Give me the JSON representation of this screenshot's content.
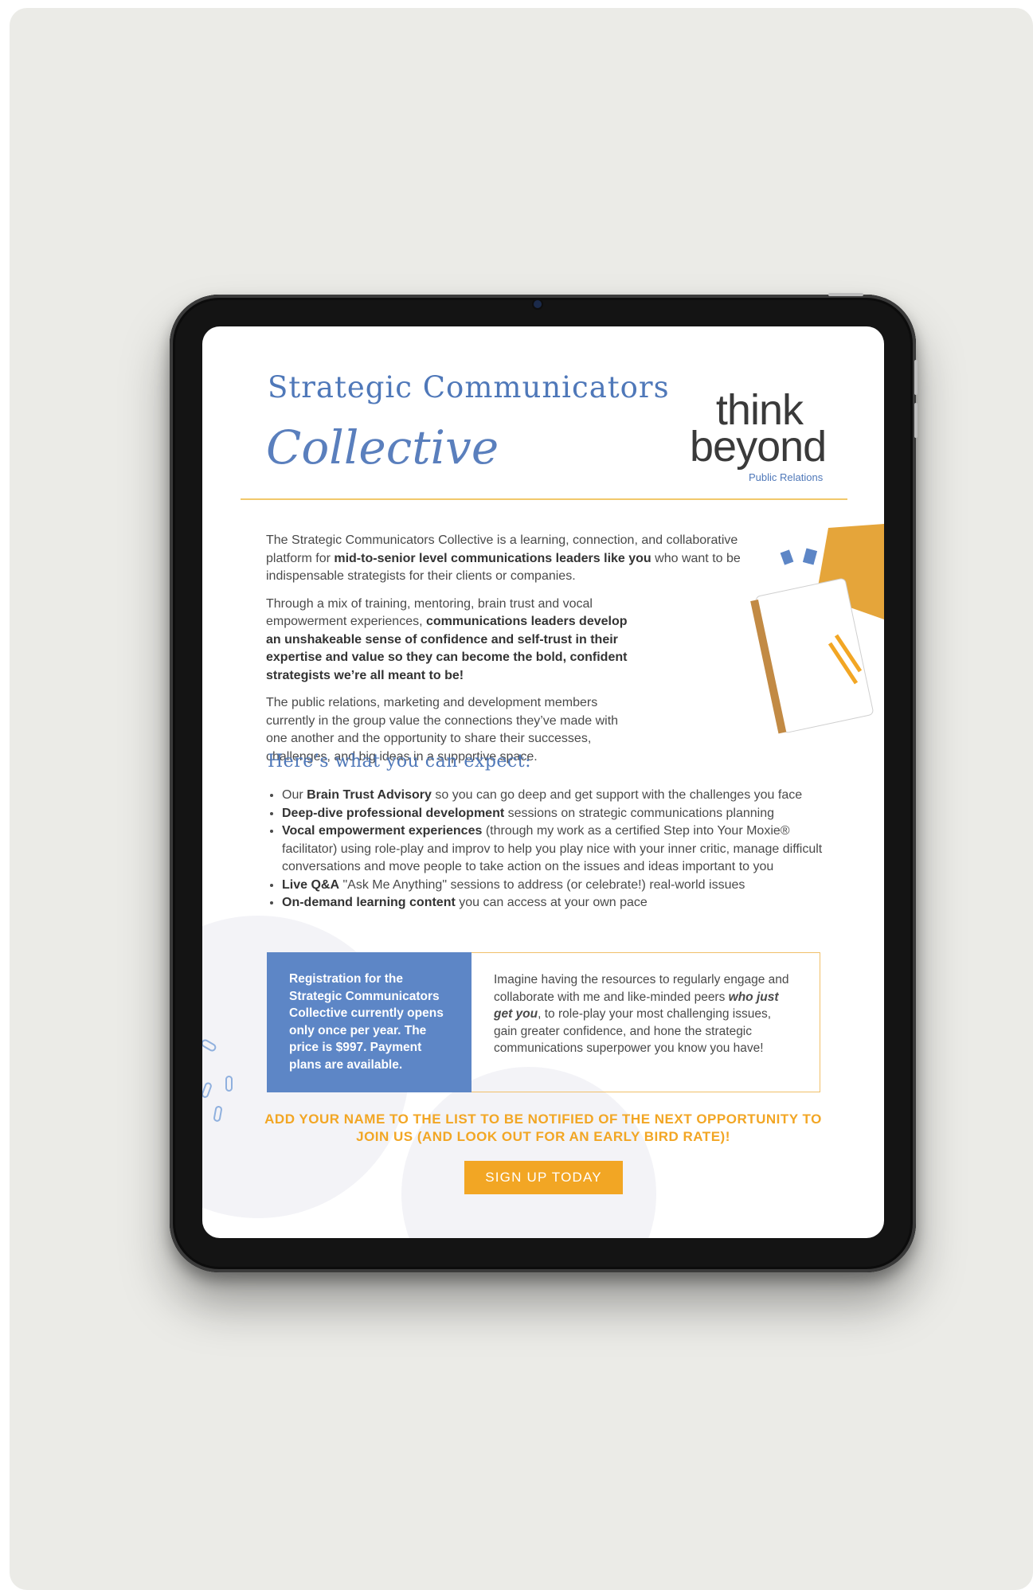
{
  "document": {
    "title_line1": "Strategic Communicators",
    "title_line2": "Collective",
    "logo": {
      "line1": "think",
      "line2": "beyond",
      "line3": "Public Relations"
    },
    "intro_paragraphs": [
      {
        "before": "The Strategic Communicators Collective is a learning, connection, and collaborative platform for ",
        "bold": "mid-to-senior level communications leaders like you",
        "after": " who want to be indispensable strategists for their clients or companies."
      },
      {
        "before": "Through a mix of training, mentoring, brain trust and vocal empowerment experiences, ",
        "bold": "communications leaders develop an unshakeable sense of confidence and self-trust in their expertise and value so they can become the bold, confident strategists we’re all meant to be!",
        "after": ""
      },
      {
        "before": "The public relations, marketing and development members currently in the group value the connections they’ve made with one another and the opportunity to share their successes, challenges, and big ideas in a supportive space.",
        "bold": "",
        "after": ""
      }
    ],
    "expect_heading": "Here’s what you can expect:",
    "bullets": [
      {
        "before": "Our ",
        "bold": "Brain Trust Advisory",
        "after": " so you can go deep and get support with the challenges you face"
      },
      {
        "before": "",
        "bold": "Deep-dive professional development",
        "after": " sessions on strategic communications planning"
      },
      {
        "before": "",
        "bold": "Vocal empowerment experiences",
        "after": " (through my work as a certified Step into Your Moxie® facilitator) using role-play and improv to help you play nice with your inner critic, manage difficult conversations and move people to take action on the issues and ideas important to you"
      },
      {
        "before": "",
        "bold": "Live Q&A",
        "after": " \"Ask Me Anything\" sessions to address (or celebrate!) real-world issues"
      },
      {
        "before": "",
        "bold": "On-demand learning content",
        "after": " you can access at your own pace"
      }
    ],
    "registration_box": "Registration for the Strategic Communicators Collective currently opens only once per year. The price is $997. Payment plans are available.",
    "imagine_box": {
      "before": "Imagine having the resources to regularly engage and collaborate with me and like-minded peers ",
      "bold": "who just get you",
      "after": ", to role-play your most challenging issues, gain greater confidence, and hone the strategic communications superpower you know you have!"
    },
    "cta_text": "ADD YOUR NAME TO THE LIST TO BE NOTIFIED OF THE NEXT OPPORTUNITY TO JOIN US (AND LOOK OUT FOR AN EARLY BIRD RATE)!",
    "cta_button": "SIGN UP TODAY"
  },
  "colors": {
    "accent_blue": "#4f78b9",
    "accent_gold": "#f2a624",
    "divider_gold": "#f1c86b",
    "panel_blue": "#5d86c6"
  }
}
